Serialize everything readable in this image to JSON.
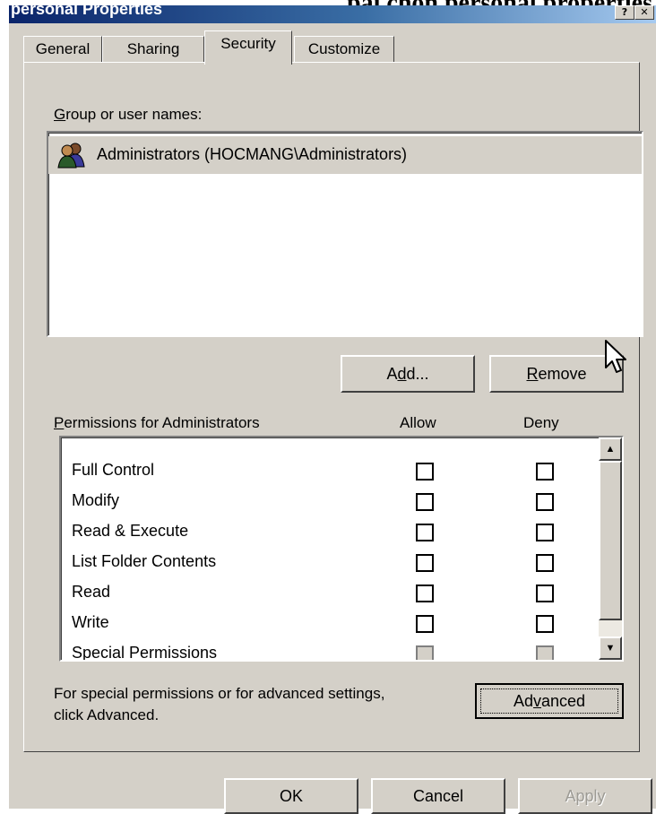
{
  "background_caption": {
    "left_text": "personal Properties",
    "right_text": "pải chọn personal properties"
  },
  "window": {
    "title": "personal Properties",
    "help_icon": "help-icon",
    "close_icon": "close-icon",
    "help_glyph": "?",
    "close_glyph": "✕"
  },
  "tabs": [
    {
      "label": "General",
      "active": false
    },
    {
      "label": "Sharing",
      "active": false
    },
    {
      "label": "Security",
      "active": true
    },
    {
      "label": "Customize",
      "active": false
    }
  ],
  "group_section": {
    "label_prefix": "G",
    "label_rest": "roup or user names:",
    "items": [
      {
        "icon": "users-group-icon",
        "label": "Administrators (HOCMANG\\Administrators)",
        "selected": true
      }
    ]
  },
  "buttons": {
    "add_pre": "A",
    "add_u": "d",
    "add_post": "d...",
    "remove_u": "R",
    "remove_post": "emove",
    "advanced_pre": "Ad",
    "advanced_u": "v",
    "advanced_post": "anced",
    "ok": "OK",
    "cancel": "Cancel",
    "apply": "Apply"
  },
  "permissions": {
    "label_u": "P",
    "label_rest": "ermissions for Administrators",
    "allow_header": "Allow",
    "deny_header": "Deny",
    "rows": [
      {
        "name": "Full Control",
        "allow": false,
        "deny": false
      },
      {
        "name": "Modify",
        "allow": false,
        "deny": false
      },
      {
        "name": "Read & Execute",
        "allow": false,
        "deny": false
      },
      {
        "name": "List Folder Contents",
        "allow": false,
        "deny": false
      },
      {
        "name": "Read",
        "allow": false,
        "deny": false
      },
      {
        "name": "Write",
        "allow": false,
        "deny": false
      },
      {
        "name": "Special Permissions",
        "allow": false,
        "deny": false,
        "disabled": true
      }
    ]
  },
  "advanced_info": {
    "line1": "For special permissions or for advanced settings,",
    "line2": "click Advanced."
  },
  "colors": {
    "dialog_face": "#d4d0c8",
    "title_gradient_start": "#0a246a",
    "selected_row": "#d4d0c8"
  },
  "scroll_glyphs": {
    "up": "▲",
    "down": "▼"
  }
}
